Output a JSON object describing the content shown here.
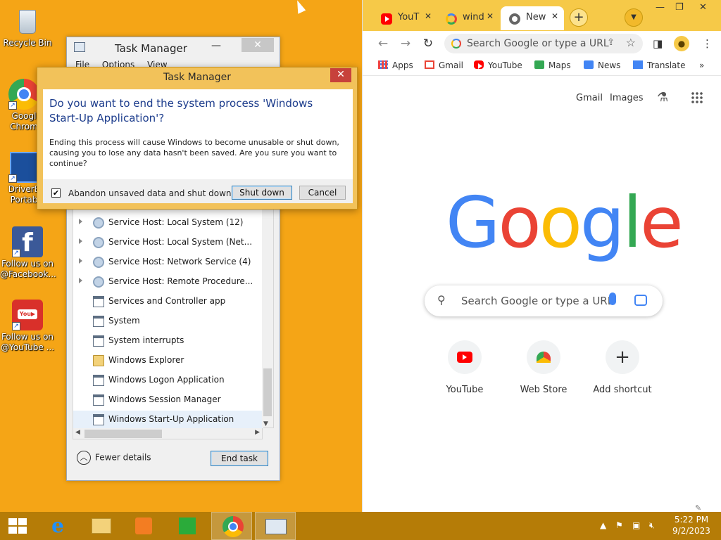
{
  "desktop_icons": [
    {
      "label": "Recycle Bin"
    },
    {
      "label": "Googl\nChrom"
    },
    {
      "label": "DriverE\nPortab"
    },
    {
      "label": "Follow us on\n@Facebook..."
    },
    {
      "label": "Follow us on\n@YouTube ..."
    }
  ],
  "task_manager": {
    "title": "Task Manager",
    "menu": [
      "File",
      "Options",
      "View"
    ],
    "processes": [
      {
        "name": "Service Host: Local System (12)",
        "expandable": true,
        "icon": "gear-icon"
      },
      {
        "name": "Service Host: Local System (Net...",
        "expandable": true,
        "icon": "gear-icon"
      },
      {
        "name": "Service Host: Network Service (4)",
        "expandable": true,
        "icon": "gear-icon"
      },
      {
        "name": "Service Host: Remote Procedure...",
        "expandable": true,
        "icon": "gear-icon"
      },
      {
        "name": "Services and Controller app",
        "expandable": false,
        "icon": "app-icon"
      },
      {
        "name": "System",
        "expandable": false,
        "icon": "app-icon"
      },
      {
        "name": "System interrupts",
        "expandable": false,
        "icon": "app-icon"
      },
      {
        "name": "Windows Explorer",
        "expandable": false,
        "icon": "folder-icon"
      },
      {
        "name": "Windows Logon Application",
        "expandable": false,
        "icon": "app-icon"
      },
      {
        "name": "Windows Session Manager",
        "expandable": false,
        "icon": "app-icon"
      },
      {
        "name": "Windows Start-Up Application",
        "expandable": false,
        "icon": "app-icon",
        "selected": true
      }
    ],
    "fewer_details": "Fewer details",
    "end_task": "End task"
  },
  "dialog": {
    "title": "Task Manager",
    "question": "Do you want to end the system process 'Windows Start-Up Application'?",
    "description": "Ending this process will cause Windows to become unusable or shut down, causing you to lose any data hasn't been saved. Are you sure you want to continue?",
    "checkbox_label": "Abandon unsaved data and shut down.",
    "checkbox_checked": true,
    "shutdown_label": "Shut down",
    "cancel_label": "Cancel"
  },
  "chrome": {
    "tabs": [
      {
        "label": "YouT",
        "icon": "youtube-icon"
      },
      {
        "label": "wind",
        "icon": "google-icon"
      },
      {
        "label": "New",
        "icon": "chrome-icon",
        "active": true
      }
    ],
    "omnibox_placeholder": "Search Google or type a URL",
    "bookmarks": [
      "Apps",
      "Gmail",
      "YouTube",
      "Maps",
      "News",
      "Translate"
    ],
    "ntp": {
      "top_links": [
        "Gmail",
        "Images"
      ],
      "logo_text": "Google",
      "search_placeholder": "Search Google or type a URL",
      "shortcuts": [
        "YouTube",
        "Web Store",
        "Add shortcut"
      ]
    }
  },
  "taskbar": {
    "time": "5:22 PM",
    "date": "9/2/2023"
  },
  "colors": {
    "desktop": "#f5a516",
    "taskbar": "#b57c07",
    "google_blue": "#4285f4",
    "google_red": "#ea4335",
    "google_yellow": "#fbbc05",
    "google_green": "#34a853"
  }
}
